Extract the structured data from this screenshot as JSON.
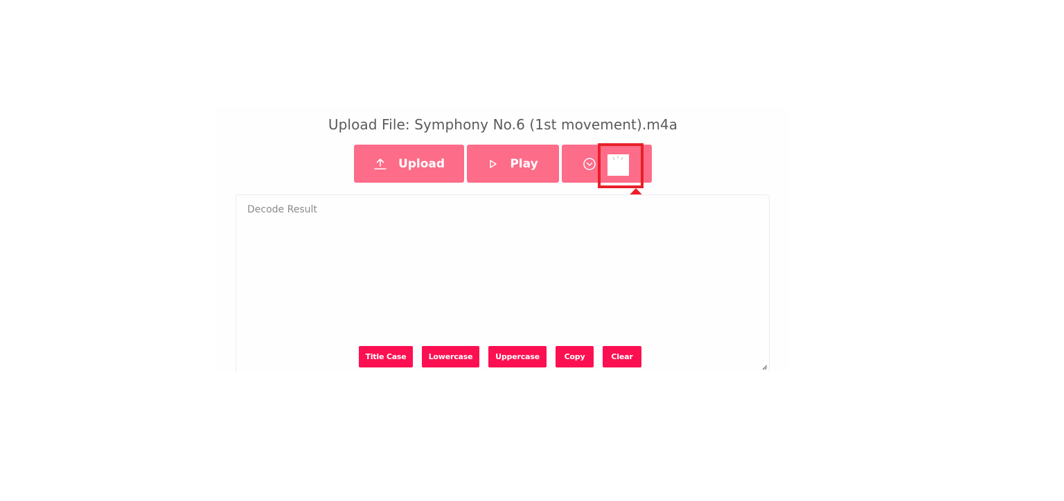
{
  "upload_panel": {
    "title": "Upload File: Symphony No.6 (1st movement).m4a",
    "buttons": {
      "upload_label": "Upload",
      "play_label": "Play"
    }
  },
  "result": {
    "placeholder": "Decode Result"
  },
  "text_actions": {
    "title_case": "Title Case",
    "lowercase": "Lowercase",
    "uppercase": "Uppercase",
    "copy": "Copy",
    "clear": "Clear"
  },
  "colors": {
    "primary_button": "#fd6c88",
    "action_button": "#fc1051",
    "highlight": "#e8202a"
  },
  "icons": {
    "upload": "upload-icon",
    "play": "play-icon",
    "more": "chevron-circle-down-icon",
    "loading": "loading-spinner-icon",
    "annotation": "up-arrow-icon"
  }
}
